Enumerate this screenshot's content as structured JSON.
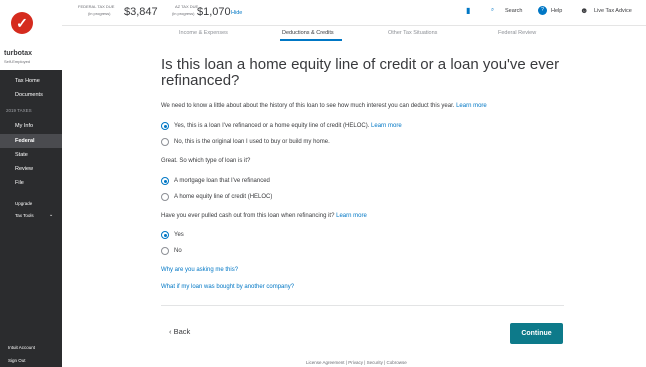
{
  "sidebar": {
    "brand": "turbotax",
    "brand_sub": "Self-Employed",
    "items": [
      {
        "label": "Tax Home"
      },
      {
        "label": "Documents"
      }
    ],
    "section_title": "2019 TAXES",
    "tax_items": [
      {
        "label": "My Info"
      },
      {
        "label": "Federal"
      },
      {
        "label": "State"
      },
      {
        "label": "Review"
      },
      {
        "label": "File"
      }
    ],
    "upgrade": "Upgrade",
    "tax_tools": "Tax Tools",
    "intuit_account": "Intuit Account",
    "sign_out": "Sign Out"
  },
  "topbar": {
    "federal_label": "FEDERAL TAX DUE",
    "federal_sub": "(in progress)",
    "federal_amount": "$3,847",
    "state_label": "AZ TAX DUE",
    "state_sub": "(in progress)",
    "state_amount": "$1,070",
    "hide": "Hide",
    "search": "Search",
    "help": "Help",
    "live_advice": "Live Tax Advice"
  },
  "tabs": [
    {
      "label": "Income & Expenses"
    },
    {
      "label": "Deductions & Credits"
    },
    {
      "label": "Other Tax Situations"
    },
    {
      "label": "Federal Review"
    }
  ],
  "page": {
    "title": "Is this loan a home equity line of credit or a loan you've ever refinanced?",
    "intro": "We need to know a little about about the history of this loan to see how much interest you can deduct this year.",
    "intro_link": "Learn more",
    "q1_opt1": "Yes, this is a loan I've refinanced or a home equity line of credit (HELOC).",
    "q1_opt1_link": "Learn more",
    "q1_opt2": "No, this is the original loan I used to buy or build my home.",
    "q2_title": "Great. So which type of loan is it?",
    "q2_opt1": "A mortgage loan that I've refinanced",
    "q2_opt2": "A home equity line of credit (HELOC)",
    "q3_title": "Have you ever pulled cash out from this loan when refinancing it?",
    "q3_link": "Learn more",
    "q3_opt1": "Yes",
    "q3_opt2": "No",
    "why_link": "Why are you asking me this?",
    "bought_link": "What if my loan was bought by another company?",
    "back": "Back",
    "continue": "Continue",
    "footer": "License Agreement | Privacy | Security | Cobrowse"
  },
  "colors": {
    "accent": "#0077c5",
    "sidebar": "#2b2c2e",
    "continue": "#0d7a8a",
    "brand_red": "#d52b1e"
  }
}
